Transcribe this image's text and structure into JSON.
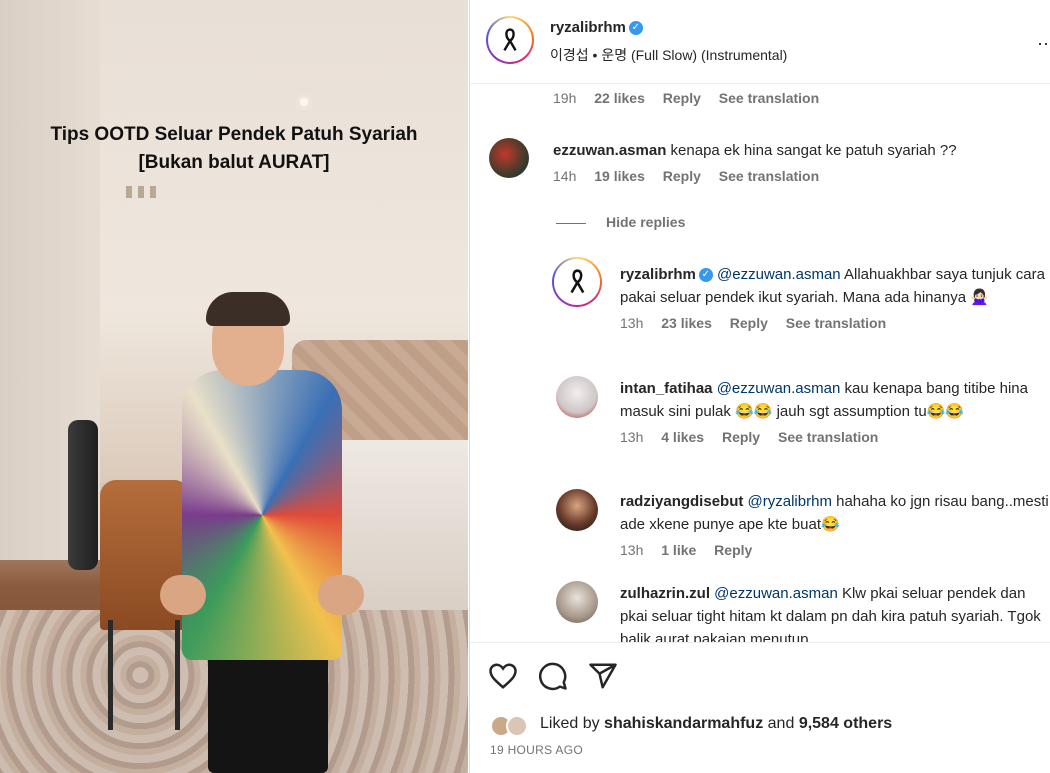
{
  "video": {
    "overlay_line1": "Tips OOTD Seluar Pendek Patuh Syariah",
    "overlay_line2": "[Bukan balut AURAT]"
  },
  "header": {
    "username": "ryzalibrhm",
    "audio": "이경섭 • 운명 (Full Slow) (Instrumental)",
    "more_icon": "more-icon"
  },
  "comments": {
    "prev_meta": {
      "time": "19h",
      "likes": "22 likes",
      "reply": "Reply",
      "translate": "See translation"
    },
    "c1": {
      "user": "ezzuwan.asman",
      "text": "kenapa ek hina sangat ke patuh syariah ??",
      "time": "14h",
      "likes": "19 likes",
      "reply": "Reply",
      "translate": "See translation"
    },
    "hide_replies": "Hide replies",
    "r1": {
      "user": "ryzalibrhm",
      "mention": "@ezzuwan.asman",
      "text": "Allahuakhbar saya tunjuk cara pakai seluar pendek ikut syariah. Mana ada hinanya 🙅🏻‍♀️",
      "time": "13h",
      "likes": "23 likes",
      "reply": "Reply",
      "translate": "See translation"
    },
    "r2": {
      "user": "intan_fatihaa",
      "mention": "@ezzuwan.asman",
      "text": "kau kenapa bang titibe hina masuk sini pulak 😂😂 jauh sgt assumption tu😂😂",
      "time": "13h",
      "likes": "4 likes",
      "reply": "Reply",
      "translate": "See translation"
    },
    "r3": {
      "user": "radziyangdisebut",
      "mention": "@ryzalibrhm",
      "text": "hahaha ko jgn risau bang..mesti ade xkene punye ape kte buat😂",
      "time": "13h",
      "likes": "1 like",
      "reply": "Reply"
    },
    "r4": {
      "user": "zulhazrin.zul",
      "mention": "@ezzuwan.asman",
      "text": "Klw pkai seluar pendek dan pkai seluar tight hitam kt dalam pn dah kira patuh syariah. Tgok balik aurat pakaian menutup"
    }
  },
  "actions": {
    "liked_by_prefix": "Liked by",
    "liked_by_user": "shahiskandarmahfuz",
    "liked_by_and": "and",
    "liked_by_others": "9,584 others",
    "time_ago": "19 HOURS AGO"
  },
  "colors": {
    "verified": "#3897f0",
    "mention": "#00376b",
    "muted": "#737373"
  }
}
